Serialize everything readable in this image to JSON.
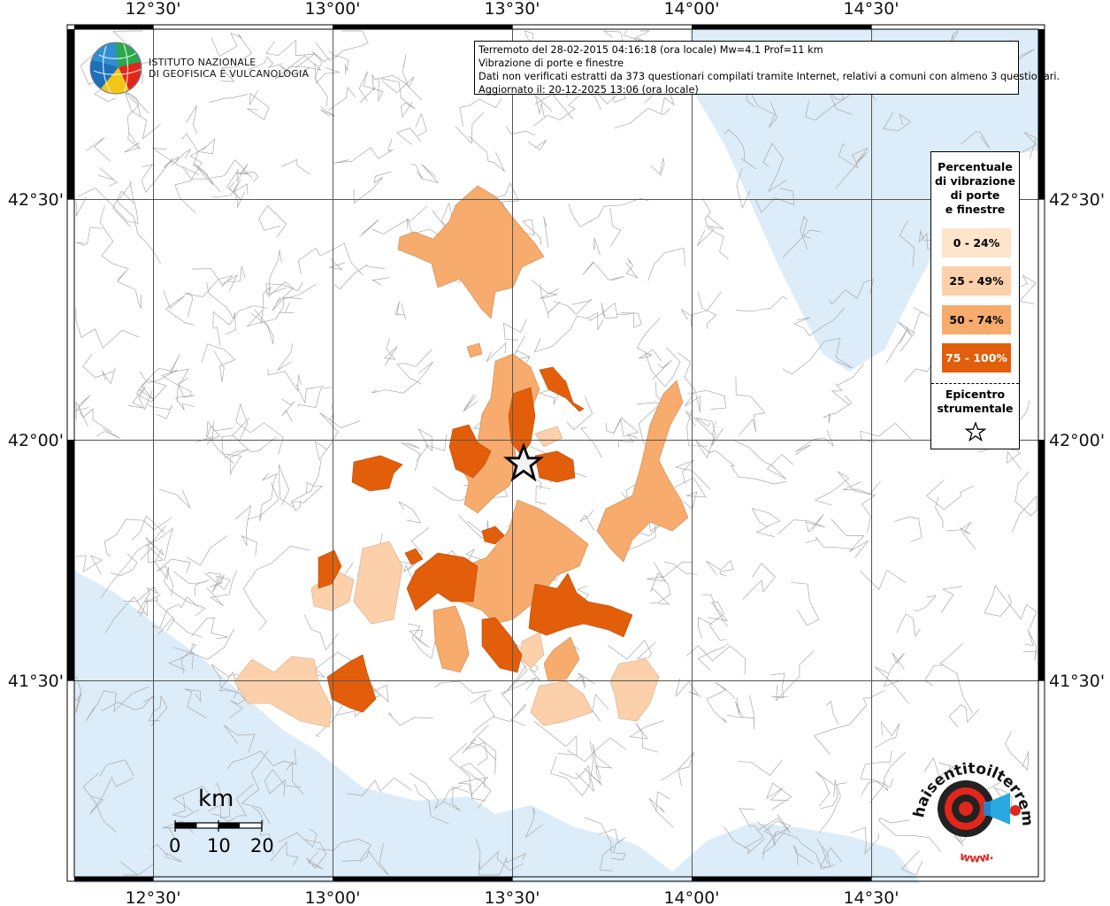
{
  "header": {
    "line1": "Terremoto del 28-02-2015 04:16:18 (ora locale) Mw=4.1 Prof=11 km",
    "line2": "Vibrazione di porte e finestre",
    "line3": "Dati non verificati estratti da 373 questionari compilati tramite Internet, relativi a comuni con almeno 3 questionari.",
    "line4": "Aggiornato il: 20-12-2025 13:06 (ora locale)"
  },
  "logo": {
    "line1": "ISTITUTO NAZIONALE",
    "line2": "DI GEOFISICA E VULCANOLOGIA"
  },
  "axes": {
    "lon_ticks": [
      "12°30'",
      "13°00'",
      "13°30'",
      "14°00'",
      "14°30'"
    ],
    "lat_ticks": [
      "42°30'",
      "42°00'",
      "41°30'"
    ]
  },
  "legend": {
    "title": [
      "Percentuale",
      "di vibrazione",
      "di porte",
      "e finestre"
    ],
    "classes": [
      {
        "label": "0 - 24%",
        "color": "#fde5cc",
        "text_color": "#000000"
      },
      {
        "label": "25 - 49%",
        "color": "#fbd0aa",
        "text_color": "#000000"
      },
      {
        "label": "50 - 74%",
        "color": "#f7ab6c",
        "text_color": "#000000"
      },
      {
        "label": "75 - 100%",
        "color": "#e25e0a",
        "text_color": "#ffffff"
      }
    ],
    "epicenter_label": [
      "Epicentro",
      "strumentale"
    ]
  },
  "scale": {
    "unit": "km",
    "labels": [
      "0",
      "10",
      "20"
    ]
  },
  "brand": {
    "text": "haisentitoilterremoto.it",
    "www": "www."
  },
  "colors": {
    "sea": "#dcecf8",
    "land": "#ffffff",
    "border": "#aaaaaa",
    "grid": "#555555"
  },
  "icons": [
    "ingv-globe-icon",
    "epicenter-star-icon",
    "haisentito-logo-icon"
  ]
}
